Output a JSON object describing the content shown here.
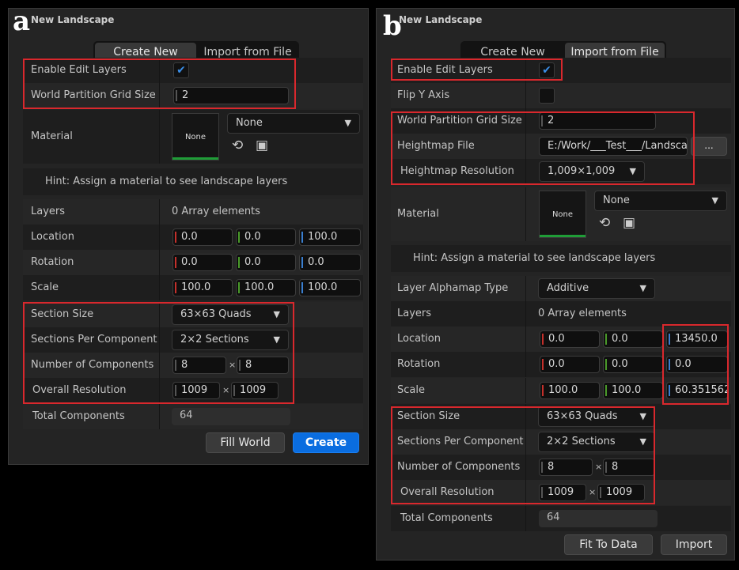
{
  "panel_a": {
    "corner_label": "a",
    "title": "New Landscape",
    "tabs": [
      "Create New",
      "Import from File"
    ],
    "enable_edit_layers": {
      "label": "Enable Edit Layers",
      "checked": true
    },
    "grid_size": {
      "label": "World Partition Grid Size",
      "value": "2"
    },
    "material": {
      "label": "Material",
      "thumb": "None",
      "dropdown": "None"
    },
    "hint": "Hint: Assign a material to see landscape layers",
    "layers": {
      "label": "Layers",
      "value": "0 Array elements"
    },
    "location": {
      "label": "Location",
      "x": "0.0",
      "y": "0.0",
      "z": "100.0"
    },
    "rotation": {
      "label": "Rotation",
      "x": "0.0",
      "y": "0.0",
      "z": "0.0"
    },
    "scale": {
      "label": "Scale",
      "x": "100.0",
      "y": "100.0",
      "z": "100.0"
    },
    "section_size": {
      "label": "Section Size",
      "value": "63×63 Quads"
    },
    "sections_per_component": {
      "label": "Sections Per Component",
      "value": "2×2 Sections"
    },
    "num_components": {
      "label": "Number of Components",
      "x": "8",
      "y": "8",
      "sep": "×"
    },
    "overall_resolution": {
      "label": "Overall Resolution",
      "x": "1009",
      "y": "1009",
      "sep": "×"
    },
    "total_components": {
      "label": "Total Components",
      "value": "64"
    },
    "buttons": {
      "fill_world": "Fill World",
      "create": "Create"
    }
  },
  "panel_b": {
    "corner_label": "b",
    "title": "New Landscape",
    "tabs": [
      "Create New",
      "Import from File"
    ],
    "enable_edit_layers": {
      "label": "Enable Edit Layers",
      "checked": true
    },
    "flip_y": {
      "label": "Flip Y Axis",
      "checked": false
    },
    "grid_size": {
      "label": "World Partition Grid Size",
      "value": "2"
    },
    "heightmap_file": {
      "label": "Heightmap File",
      "value": "E:/Work/___Test___/Landsca",
      "browse": "..."
    },
    "heightmap_resolution": {
      "label": "Heightmap Resolution",
      "value": "1,009×1,009"
    },
    "material": {
      "label": "Material",
      "thumb": "None",
      "dropdown": "None"
    },
    "hint": "Hint: Assign a material to see landscape layers",
    "alphamap_type": {
      "label": "Layer Alphamap Type",
      "value": "Additive"
    },
    "layers": {
      "label": "Layers",
      "value": "0 Array elements"
    },
    "location": {
      "label": "Location",
      "x": "0.0",
      "y": "0.0",
      "z": "13450.0"
    },
    "rotation": {
      "label": "Rotation",
      "x": "0.0",
      "y": "0.0",
      "z": "0.0"
    },
    "scale": {
      "label": "Scale",
      "x": "100.0",
      "y": "100.0",
      "z": "60.351562"
    },
    "section_size": {
      "label": "Section Size",
      "value": "63×63 Quads"
    },
    "sections_per_component": {
      "label": "Sections Per Component",
      "value": "2×2 Sections"
    },
    "num_components": {
      "label": "Number of Components",
      "x": "8",
      "y": "8",
      "sep": "×"
    },
    "overall_resolution": {
      "label": "Overall Resolution",
      "x": "1009",
      "y": "1009",
      "sep": "×"
    },
    "total_components": {
      "label": "Total Components",
      "value": "64"
    },
    "buttons": {
      "fit_to_data": "Fit To Data",
      "import": "Import"
    }
  },
  "icons": {
    "reset": "reset-arrow-icon",
    "browse": "browse-asset-icon",
    "chevron": "chevron-down-icon",
    "check": "checkmark-icon"
  },
  "colors": {
    "highlight": "#d9282d",
    "accent_blue": "#0a6de0",
    "axis_x": "#c4302b",
    "axis_y": "#4a9a2a",
    "axis_z": "#3a7fd0"
  }
}
